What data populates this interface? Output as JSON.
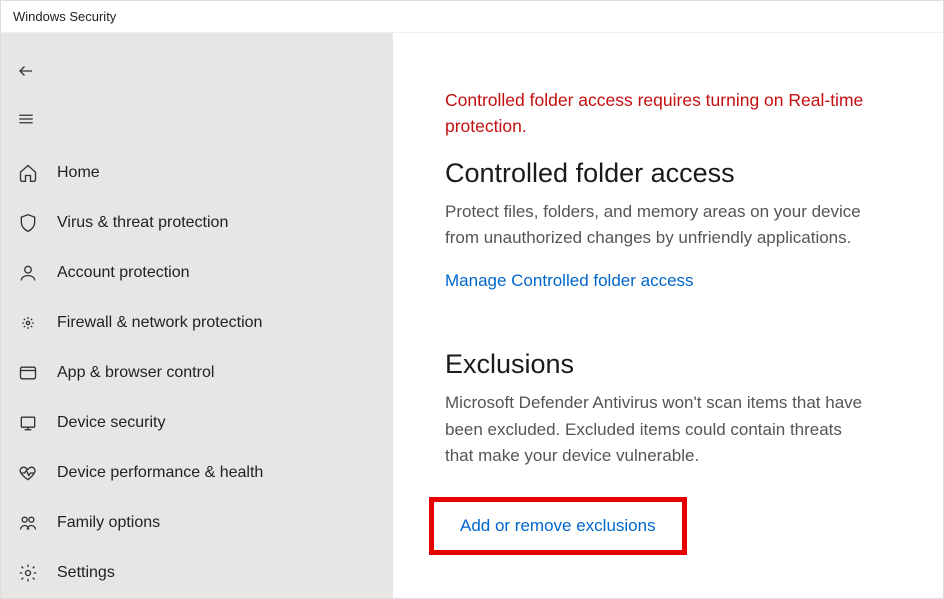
{
  "window": {
    "title": "Windows Security"
  },
  "sidebar": {
    "items": [
      {
        "label": "Home"
      },
      {
        "label": "Virus & threat protection"
      },
      {
        "label": "Account protection"
      },
      {
        "label": "Firewall & network protection"
      },
      {
        "label": "App & browser control"
      },
      {
        "label": "Device security"
      },
      {
        "label": "Device performance & health"
      },
      {
        "label": "Family options"
      }
    ],
    "settings": {
      "label": "Settings"
    }
  },
  "main": {
    "warning": "Controlled folder access requires turning on Real-time protection.",
    "cfa": {
      "title": "Controlled folder access",
      "desc": "Protect files, folders, and memory areas on your device from unauthorized changes by unfriendly applications.",
      "link": "Manage Controlled folder access"
    },
    "exclusions": {
      "title": "Exclusions",
      "desc": "Microsoft Defender Antivirus won't scan items that have been excluded. Excluded items could contain threats that make your device vulnerable.",
      "link": "Add or remove exclusions"
    }
  }
}
